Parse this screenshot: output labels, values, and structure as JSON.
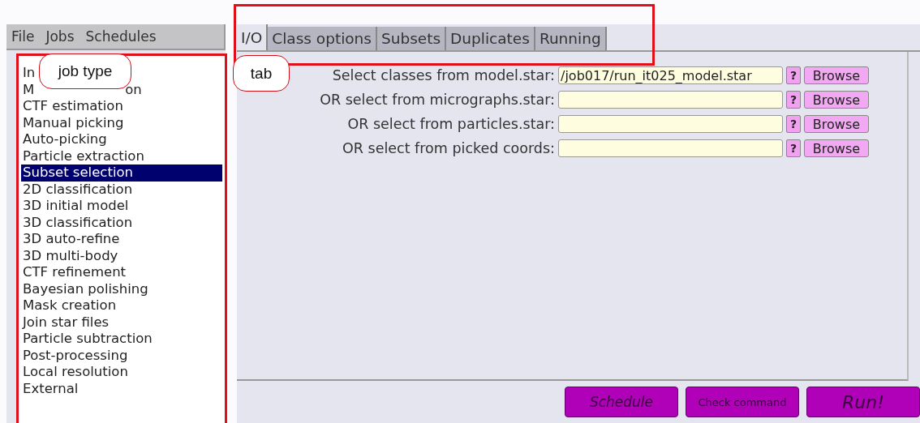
{
  "menu": [
    "File",
    "Jobs",
    "Schedules"
  ],
  "job_list": [
    {
      "label": "In",
      "selected": false
    },
    {
      "label": "M",
      "label_tail": "on",
      "selected": false
    },
    {
      "label": "CTF estimation",
      "selected": false
    },
    {
      "label": "Manual picking",
      "selected": false
    },
    {
      "label": "Auto-picking",
      "selected": false
    },
    {
      "label": "Particle extraction",
      "selected": false
    },
    {
      "label": "Subset selection",
      "selected": true
    },
    {
      "label": "2D classification",
      "selected": false
    },
    {
      "label": "3D initial model",
      "selected": false
    },
    {
      "label": "3D classification",
      "selected": false
    },
    {
      "label": "3D auto-refine",
      "selected": false
    },
    {
      "label": "3D multi-body",
      "selected": false
    },
    {
      "label": "CTF refinement",
      "selected": false
    },
    {
      "label": "Bayesian polishing",
      "selected": false
    },
    {
      "label": "Mask creation",
      "selected": false
    },
    {
      "label": "Join star files",
      "selected": false
    },
    {
      "label": "Particle subtraction",
      "selected": false
    },
    {
      "label": "Post-processing",
      "selected": false
    },
    {
      "label": "Local resolution",
      "selected": false
    },
    {
      "label": "External",
      "selected": false
    }
  ],
  "tabs": [
    {
      "label": "I/O",
      "selected": true
    },
    {
      "label": "Class options",
      "selected": false
    },
    {
      "label": "Subsets",
      "selected": false
    },
    {
      "label": "Duplicates",
      "selected": false
    },
    {
      "label": "Running",
      "selected": false
    }
  ],
  "fields": [
    {
      "label": "Select classes from model.star:",
      "value": "/job017/run_it025_model.star",
      "help": "?",
      "browse": "Browse"
    },
    {
      "label": "OR select from micrographs.star:",
      "help": "?",
      "browse": "Browse"
    },
    {
      "label": "OR select from particles.star:",
      "help": "?",
      "browse": "Browse"
    },
    {
      "label": "OR select from picked coords:",
      "help": "?",
      "browse": "Browse"
    }
  ],
  "actions": [
    {
      "label": "Schedule",
      "kind": "italic"
    },
    {
      "label": "Check command",
      "kind": "small"
    },
    {
      "label": "Run!",
      "kind": "large"
    }
  ],
  "job_list_callout": "job type",
  "tabs_callout": "tab"
}
